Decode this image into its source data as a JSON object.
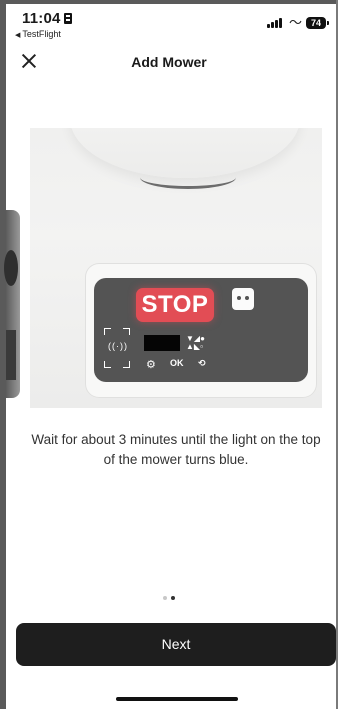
{
  "status_bar": {
    "time": "11:04",
    "back_app": "TestFlight",
    "battery": "74"
  },
  "header": {
    "title": "Add Mower"
  },
  "illustration": {
    "stop_label": "STOP",
    "ok_label": "OK",
    "stop_color": "#e24d55",
    "panel_color": "#545454"
  },
  "instruction": "Wait for about 3 minutes until the light on the top of the mower turns blue.",
  "pager": {
    "total": 2,
    "current": 2
  },
  "next_button": {
    "label": "Next"
  }
}
